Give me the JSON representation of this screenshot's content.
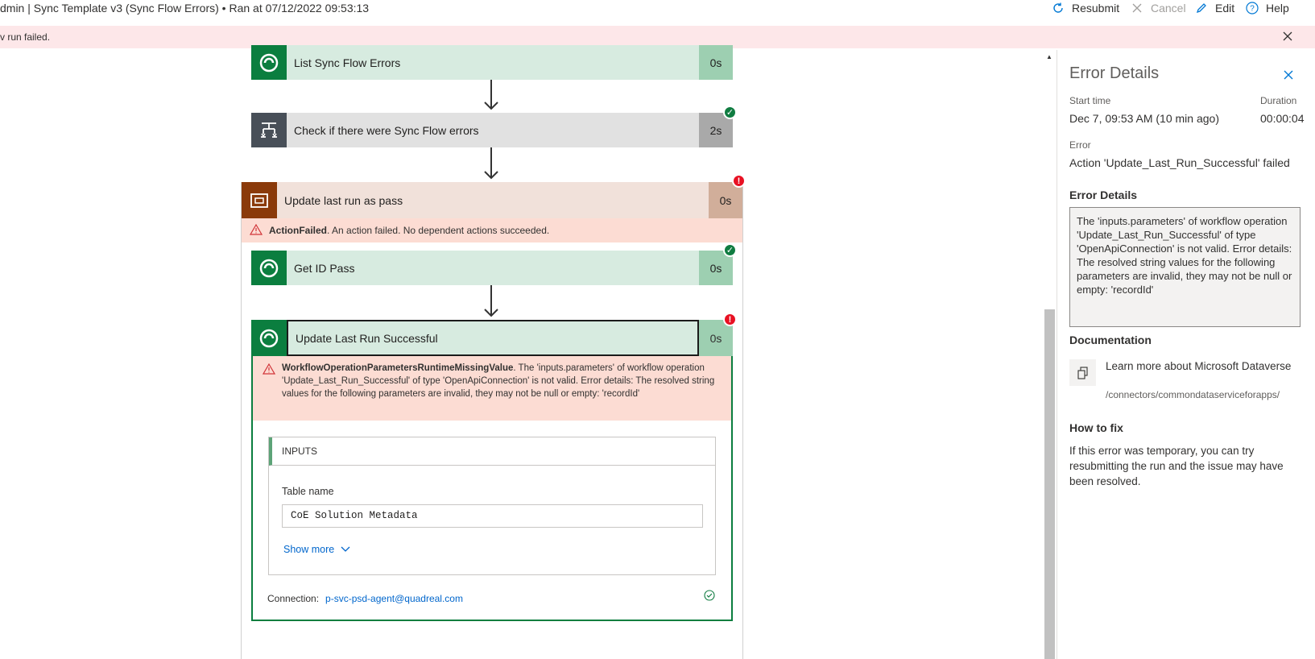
{
  "header": {
    "title": "dmin | Sync Template v3 (Sync Flow Errors) • Ran at 07/12/2022 09:53:13",
    "commands": {
      "resubmit": "Resubmit",
      "cancel": "Cancel",
      "edit": "Edit",
      "help": "Help"
    }
  },
  "banner": {
    "message": "v run failed."
  },
  "steps": {
    "list_errors": {
      "label": "List Sync Flow Errors",
      "duration": "0s"
    },
    "check_errors": {
      "label": "Check if there were Sync Flow errors",
      "duration": "2s"
    },
    "update_pass": {
      "label": "Update last run as pass",
      "duration": "0s"
    },
    "get_id": {
      "label": "Get ID Pass",
      "duration": "0s"
    },
    "update_success": {
      "label": "Update Last Run Successful",
      "duration": "0s"
    }
  },
  "scope_error": {
    "code": "ActionFailed",
    "text": ". An action failed. No dependent actions succeeded."
  },
  "action_error": {
    "code": "WorkflowOperationParametersRuntimeMissingValue",
    "text": ". The 'inputs.parameters' of workflow operation 'Update_Last_Run_Successful' of type 'OpenApiConnection' is not valid. Error details: The resolved string values for the following parameters are invalid, they may not be null or empty: 'recordId'"
  },
  "inputs": {
    "header": "INPUTS",
    "table_name_label": "Table name",
    "table_name_value": "CoE Solution Metadata",
    "show_more": "Show more"
  },
  "connection": {
    "label": "Connection:",
    "value": "p-svc-psd-agent@quadreal.com"
  },
  "panel": {
    "title": "Error Details",
    "start_time_label": "Start time",
    "start_time_value": "Dec 7, 09:53 AM (10 min ago)",
    "duration_label": "Duration",
    "duration_value": "00:00:04",
    "error_label": "Error",
    "error_value": "Action 'Update_Last_Run_Successful' failed",
    "details_heading": "Error Details",
    "details_text": "The 'inputs.parameters' of workflow operation 'Update_Last_Run_Successful' of type 'OpenApiConnection' is not valid. Error details: The resolved string values for the following parameters are invalid, they may not be null or empty: 'recordId'",
    "documentation_heading": "Documentation",
    "doc_link": "Learn more about Microsoft Dataverse",
    "doc_url": "/connectors/commondataserviceforapps/",
    "fix_heading": "How to fix",
    "fix_text": "If this error was temporary, you can try resubmitting the run and the issue may have been resolved."
  },
  "icons": {
    "resubmit": "resubmit-icon",
    "cancel": "cancel-icon",
    "edit": "edit-icon",
    "help": "help-icon",
    "dataverse": "dataverse-icon",
    "condition": "condition-icon",
    "scope": "scope-icon",
    "warning": "warning-icon",
    "close": "close-icon",
    "copy": "copy-icon",
    "check": "check-icon"
  },
  "colors": {
    "success": "#0b7e3f",
    "error": "#e81123",
    "link": "#0066cc",
    "banner": "#fde7e9"
  }
}
